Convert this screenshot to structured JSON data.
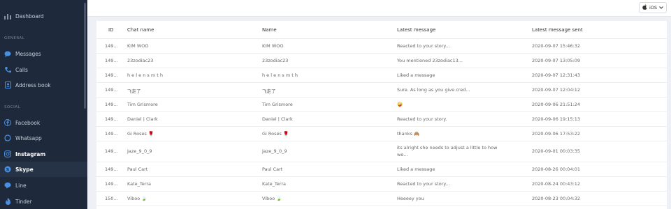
{
  "sidebar": {
    "dashboard": "Dashboard",
    "section_general": "GENERAL",
    "messages": "Messages",
    "calls": "Calls",
    "address_book": "Address book",
    "section_social": "SOCIAL",
    "facebook": "Facebook",
    "whatsapp": "Whatsapp",
    "instagram": "Instagram",
    "skype": "Skype",
    "line": "Line",
    "tinder": "Tinder"
  },
  "topbar": {
    "os_label": "iOS"
  },
  "table": {
    "headers": {
      "id": "ID",
      "chat_name": "Chat name",
      "name": "Name",
      "latest_message": "Latest message",
      "latest_sent": "Latest message sent"
    },
    "rows": [
      {
        "id": "149...",
        "chat": "KIM WOO",
        "name": "KIM WOO",
        "msg": "Reacted to your story...",
        "sent": "2020-09-07 15:46:32"
      },
      {
        "id": "149...",
        "chat": "23zodiac23",
        "name": "23zodiac23",
        "msg": "You mentioned 23zodiac13...",
        "sent": "2020-09-07 13:05:09"
      },
      {
        "id": "149...",
        "chat": "h e l e n s m t h",
        "name": "h e l e n s m t h",
        "msg": "Liked a message",
        "sent": "2020-09-07 12:31:43"
      },
      {
        "id": "149...",
        "chat": "飞走了",
        "name": "飞走了",
        "msg": "Sure. As long as you give cred...",
        "sent": "2020-09-07 12:04:12"
      },
      {
        "id": "149...",
        "chat": "Tim Grismore",
        "name": "Tim Grismore",
        "msg": "🤪",
        "sent": "2020-09-06 21:51:24"
      },
      {
        "id": "149...",
        "chat": "Daniel | Clark",
        "name": "Daniel | Clark",
        "msg": "Reacted to your story.",
        "sent": "2020-09-06 19:15:13"
      },
      {
        "id": "149...",
        "chat": "Gi Roses 🌹",
        "name": "Gi Roses 🌹",
        "msg": "thanks 🙈",
        "sent": "2020-09-06 17:53:22"
      },
      {
        "id": "149...",
        "chat": "Jaze_9_0_9",
        "name": "Jaze_9_0_9",
        "msg": "its alright she needs to adjust a little to how we...",
        "sent": "2020-09-01 00:03:35"
      },
      {
        "id": "149...",
        "chat": "Paul Cart",
        "name": "Paul Cart",
        "msg": "Liked a message",
        "sent": "2020-08-26 00:04:01"
      },
      {
        "id": "149...",
        "chat": "Kate_Terra",
        "name": "Kate_Terra",
        "msg": "Reacted to your story...",
        "sent": "2020-08-24 00:43:12"
      },
      {
        "id": "150...",
        "chat": "Viboo 🍃",
        "name": "Viboo 🍃",
        "msg": "Heeeey you",
        "sent": "2020-08-23 00:04:32"
      }
    ]
  }
}
